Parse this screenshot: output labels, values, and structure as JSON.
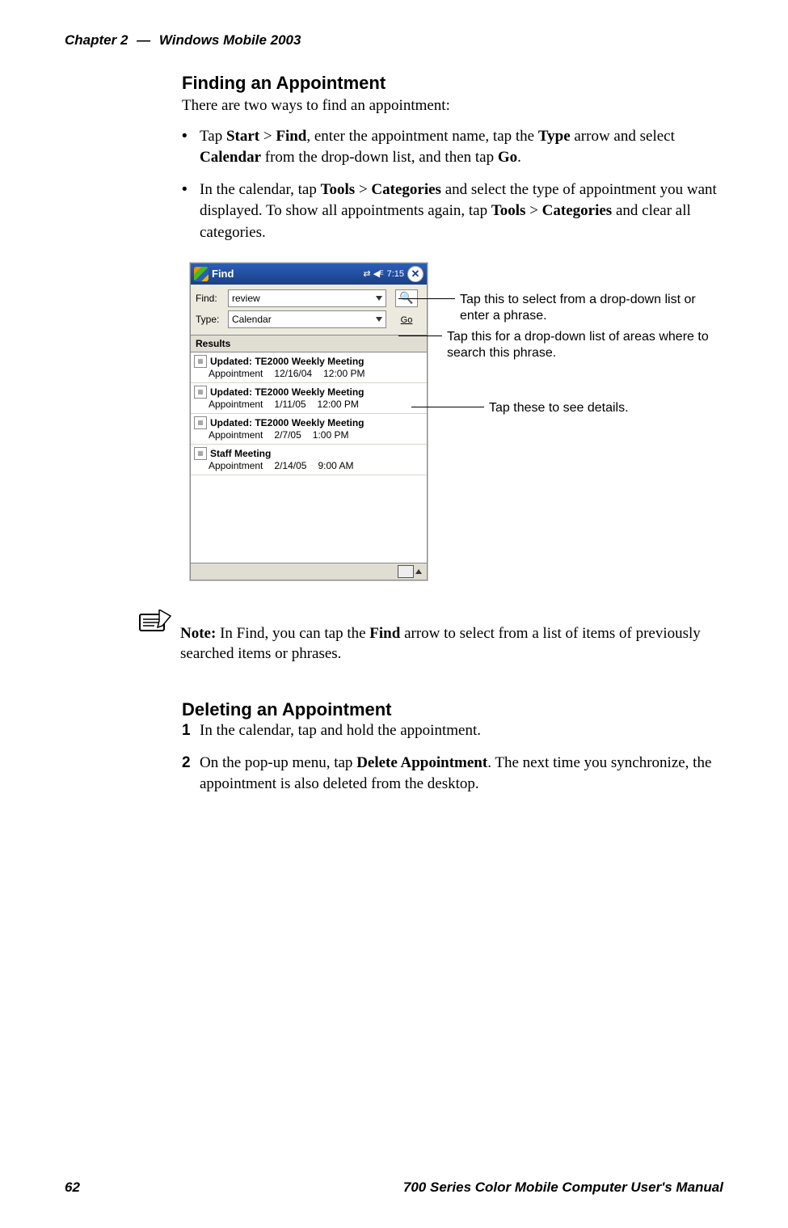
{
  "header": {
    "chapter": "Chapter 2",
    "sep": "—",
    "title": "Windows Mobile 2003"
  },
  "section1": {
    "heading": "Finding an Appointment",
    "lead": "There are two ways to find an appointment:",
    "bullets": {
      "b1": {
        "pre": "Tap ",
        "start": "Start",
        "gt1": " > ",
        "find": "Find",
        "mid1": ", enter the appointment name, tap the ",
        "type": "Type",
        "mid2": " arrow and select ",
        "calendar": "Calendar",
        "mid3": " from the drop-down list, and then tap ",
        "go": "Go",
        "end": "."
      },
      "b2": {
        "pre": "In the calendar, tap ",
        "tools1": "Tools",
        "gt1": " > ",
        "cat1": "Categories",
        "mid1": " and select the type of appoint­ment you want displayed. To show all appointments again, tap ",
        "tools2": "Tools",
        "gt2": " > ",
        "cat2": "Categories",
        "end": " and clear all categories."
      }
    }
  },
  "device": {
    "title": "Find",
    "clock": "7:15",
    "close": "✕",
    "signal": "⇄ ◀ᴱ",
    "findLabel": "Find:",
    "findValue": "review",
    "typeLabel": "Type:",
    "typeValue": "Calendar",
    "goIcon": "🔍",
    "goLabel": "Go",
    "resultsHeader": "Results",
    "rows": [
      {
        "title": "Updated: TE2000 Weekly Meeting",
        "kind": "Appointment",
        "date": "12/16/04",
        "time": "12:00 PM"
      },
      {
        "title": "Updated: TE2000 Weekly Meeting",
        "kind": "Appointment",
        "date": "1/11/05",
        "time": "12:00 PM"
      },
      {
        "title": "Updated: TE2000 Weekly Meeting",
        "kind": "Appointment",
        "date": "2/7/05",
        "time": "1:00 PM"
      },
      {
        "title": "Staff Meeting",
        "kind": "Appointment",
        "date": "2/14/05",
        "time": "9:00 AM"
      }
    ]
  },
  "callouts": {
    "c1": "Tap this to select from a drop-down list or enter a phrase.",
    "c2": "Tap this for a drop-down list of areas where to search this phrase.",
    "c3": "Tap these to see details."
  },
  "note": {
    "label": "Note:",
    "text1": " In Find, you can tap the ",
    "find": "Find",
    "text2": " arrow to select from a list of items of previously searched items or phrases."
  },
  "section2": {
    "heading": "Deleting an Appointment",
    "s1": "In the calendar, tap and hold the appointment.",
    "s2": {
      "pre": "On the pop-up menu, tap ",
      "del": "Delete Appointment",
      "post": ". The next time you synchronize, the appointment is also deleted from the desktop."
    }
  },
  "footer": {
    "pagenum": "62",
    "manual": "700 Series Color Mobile Computer User's Manual"
  }
}
